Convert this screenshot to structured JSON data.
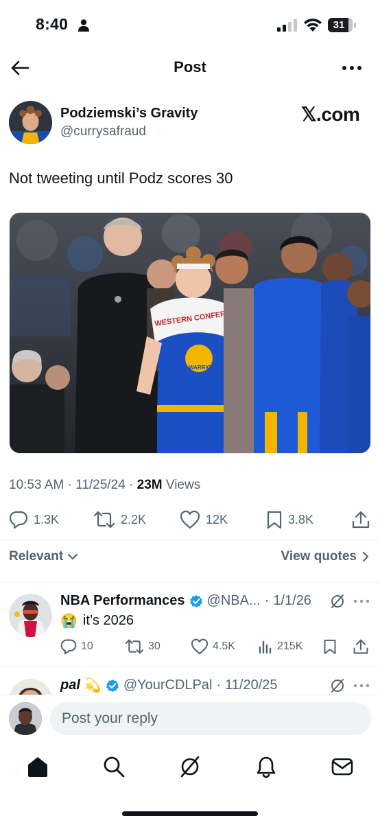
{
  "status_bar": {
    "time": "8:40",
    "battery": "31",
    "icons": [
      "person-icon",
      "signal-icon",
      "wifi-icon",
      "battery-icon"
    ]
  },
  "header": {
    "title": "Post",
    "back_icon": "back-arrow-icon",
    "more_icon": "more-icon"
  },
  "post": {
    "author_name": "Podziemski’s Gravity",
    "author_handle": "@currysafraud",
    "source": "𝕏.com",
    "text": "Not tweeting until Podz scores 30",
    "time": "10:53 AM",
    "date": "11/25/24",
    "views_count": "23M",
    "views_label": "Views",
    "meta_separator": "·",
    "image_text": {
      "towel_text": "WESTERN CONFERENCE",
      "jersey_text": "WARRIORS"
    },
    "actions": {
      "replies": "1.3K",
      "reposts": "2.2K",
      "likes": "12K",
      "bookmarks": "3.8K"
    }
  },
  "sort": {
    "label": "Relevant",
    "view_quotes": "View quotes"
  },
  "replies": [
    {
      "name": "NBA Performances",
      "handle": "@NBA...",
      "date": "1/1/26",
      "emoji": "😭",
      "text": "it’s 2026",
      "verified": true,
      "actions": {
        "replies": "10",
        "reposts": "30",
        "likes": "4.5K",
        "views": "215K"
      }
    },
    {
      "name": "pal",
      "emoji": "💫",
      "handle": "@YourCDLPal",
      "date": "11/20/25",
      "verified": true
    }
  ],
  "reply_bar": {
    "placeholder": "Post your reply"
  },
  "tab_bar": {
    "tabs": [
      "home-icon",
      "search-icon",
      "grok-icon",
      "notifications-icon",
      "messages-icon"
    ]
  },
  "colors": {
    "text_primary": "#0f1419",
    "text_secondary": "#536471",
    "verified_blue": "#1d9bf0",
    "divider": "#eff3f4"
  }
}
